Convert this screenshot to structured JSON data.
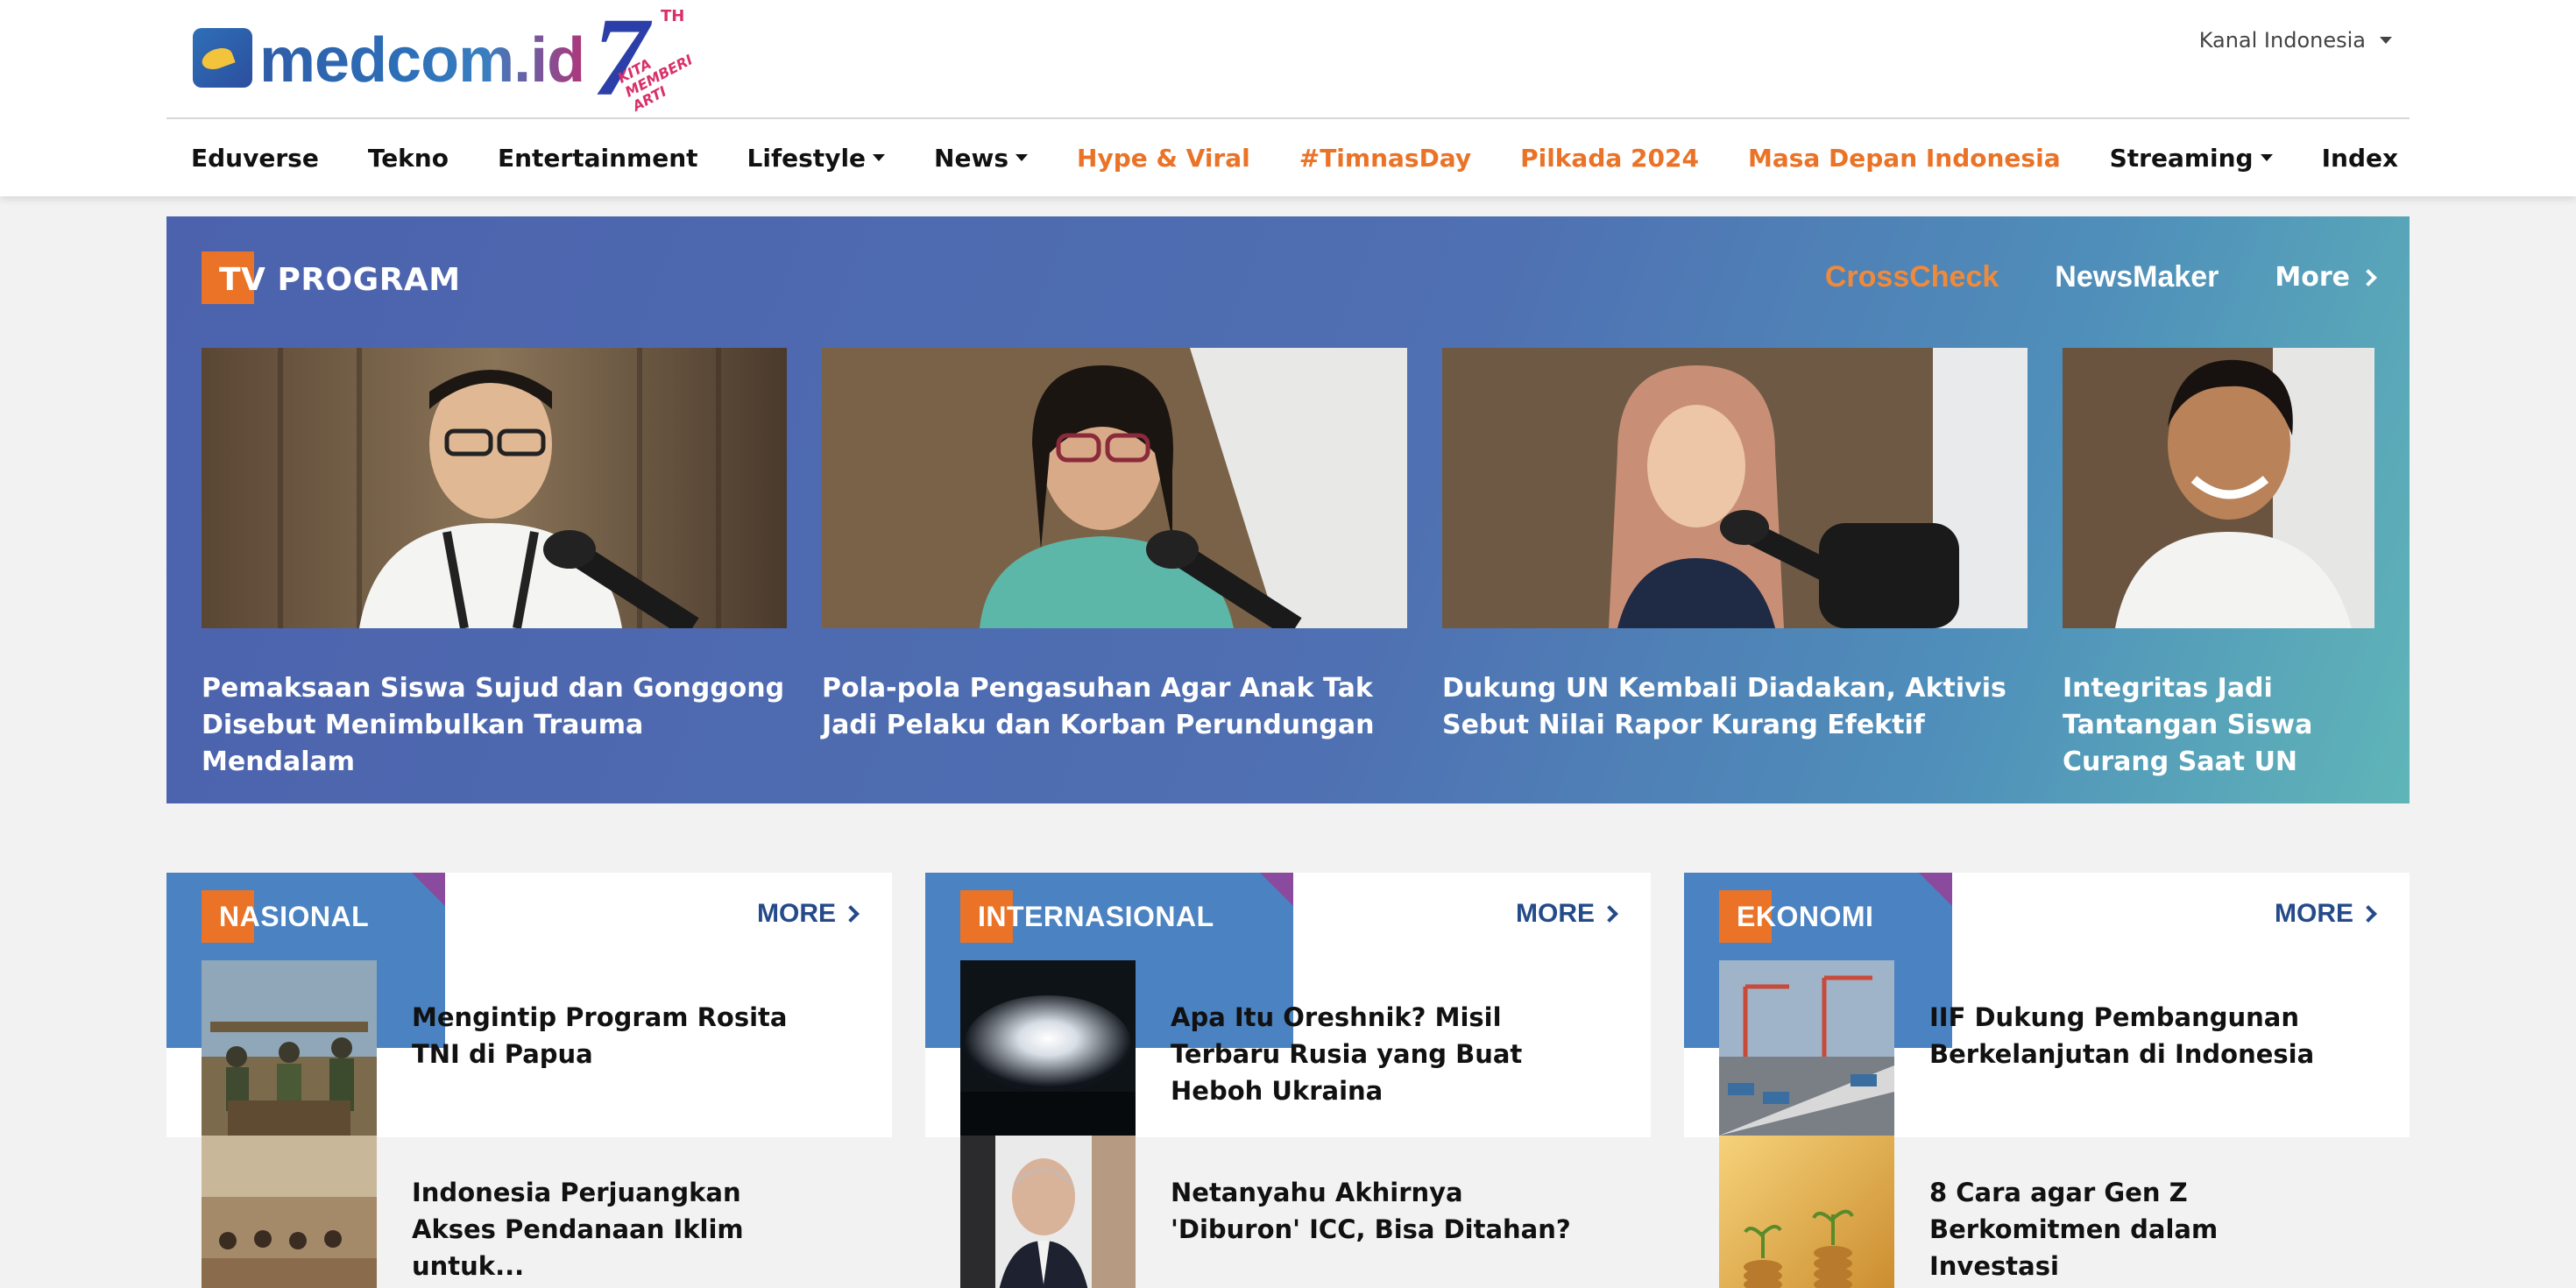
{
  "header": {
    "logo_text": "medcom.id",
    "logo_badge": {
      "number": "7",
      "sup": "TH",
      "tagline_1": "KITA",
      "tagline_2": "MEMBERI",
      "tagline_3": "ARTI"
    },
    "kanal_label": "Kanal Indonesia"
  },
  "nav": {
    "items": [
      {
        "label": "Eduverse",
        "dropdown": false,
        "highlight": false
      },
      {
        "label": "Tekno",
        "dropdown": false,
        "highlight": false
      },
      {
        "label": "Entertainment",
        "dropdown": false,
        "highlight": false
      },
      {
        "label": "Lifestyle",
        "dropdown": true,
        "highlight": false
      },
      {
        "label": "News",
        "dropdown": true,
        "highlight": false
      },
      {
        "label": "Hype & Viral",
        "dropdown": false,
        "highlight": true
      },
      {
        "label": "#TimnasDay",
        "dropdown": false,
        "highlight": true
      },
      {
        "label": "Pilkada 2024",
        "dropdown": false,
        "highlight": true
      },
      {
        "label": "Masa Depan Indonesia",
        "dropdown": false,
        "highlight": true
      },
      {
        "label": "Streaming",
        "dropdown": true,
        "highlight": false
      },
      {
        "label": "Index",
        "dropdown": false,
        "highlight": false
      }
    ]
  },
  "tv_program": {
    "title": "TV PROGRAM",
    "links": [
      "CrossCheck",
      "NewsMaker"
    ],
    "active_link": "CrossCheck",
    "more_label": "More",
    "cards": [
      {
        "title": "Pemaksaan Siswa Sujud dan Gonggong Disebut Menimbulkan Trauma Mendalam"
      },
      {
        "title": "Pola-pola Pengasuhan Agar Anak Tak Jadi Pelaku dan Korban Perundungan"
      },
      {
        "title": "Dukung UN Kembali Diadakan, Aktivis Sebut Nilai Rapor Kurang Efektif"
      },
      {
        "title": "Integritas Jadi Tantangan Siswa Curang Saat UN"
      }
    ]
  },
  "sections": [
    {
      "title": "NASIONAL",
      "more_label": "MORE",
      "items": [
        {
          "title": "Mengintip Program Rosita TNI di Papua"
        },
        {
          "title": "Indonesia Perjuangkan Akses Pendanaan Iklim untuk..."
        }
      ]
    },
    {
      "title": "INTERNASIONAL",
      "more_label": "MORE",
      "items": [
        {
          "title": "Apa Itu Oreshnik? Misil Terbaru Rusia yang Buat Heboh Ukraina"
        },
        {
          "title": "Netanyahu Akhirnya 'Diburon' ICC, Bisa Ditahan?"
        }
      ]
    },
    {
      "title": "EKONOMI",
      "more_label": "MORE",
      "items": [
        {
          "title": "IIF Dukung Pembangunan Berkelanjutan di Indonesia"
        },
        {
          "title": "8 Cara agar Gen Z Berkomitmen dalam Investasi"
        }
      ]
    }
  ],
  "colors": {
    "accent_orange": "#ea7327",
    "section_blue": "#4a82c2",
    "more_blue": "#244a8a"
  }
}
